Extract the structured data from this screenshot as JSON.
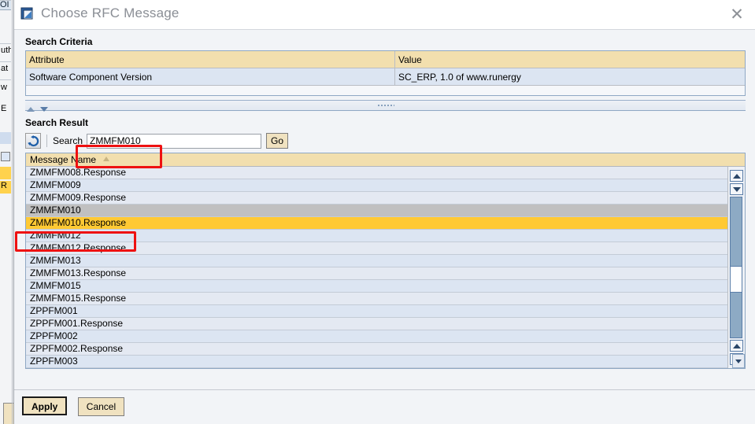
{
  "background": {
    "fragments": [
      "OI",
      "uth",
      "at",
      "w",
      "E",
      "R"
    ]
  },
  "dialog": {
    "title": "Choose RFC Message",
    "title_icon": "window-stack-icon",
    "close_icon": "close-icon"
  },
  "search_criteria": {
    "section_label": "Search Criteria",
    "columns": [
      "Attribute",
      "Value"
    ],
    "rows": [
      {
        "attribute": "Software Component Version",
        "value": "SC_ERP, 1.0 of www.runergy"
      }
    ]
  },
  "splitter": {
    "collapse_up_icon": "triangle-up-icon",
    "collapse_down_icon": "triangle-down-icon",
    "grip_icon": "grip-dots-icon"
  },
  "search_result": {
    "section_label": "Search Result",
    "refresh_icon": "refresh-icon",
    "search_label": "Search",
    "search_value": "ZMMFM010",
    "search_placeholder": "",
    "go_label": "Go",
    "column_header": "Message Name",
    "sort_icon": "sort-ascending-icon",
    "rows": [
      {
        "name": "ZMMFM008.Response",
        "state": "normal"
      },
      {
        "name": "ZMMFM009",
        "state": "normal"
      },
      {
        "name": "ZMMFM009.Response",
        "state": "normal"
      },
      {
        "name": "ZMMFM010",
        "state": "hover"
      },
      {
        "name": "ZMMFM010.Response",
        "state": "selected"
      },
      {
        "name": "ZMMFM012",
        "state": "normal"
      },
      {
        "name": "ZMMFM012.Response",
        "state": "normal"
      },
      {
        "name": "ZMMFM013",
        "state": "normal"
      },
      {
        "name": "ZMMFM013.Response",
        "state": "normal"
      },
      {
        "name": "ZMMFM015",
        "state": "normal"
      },
      {
        "name": "ZMMFM015.Response",
        "state": "normal"
      },
      {
        "name": "ZPPFM001",
        "state": "normal"
      },
      {
        "name": "ZPPFM001.Response",
        "state": "normal"
      },
      {
        "name": "ZPPFM002",
        "state": "normal"
      },
      {
        "name": "ZPPFM002.Response",
        "state": "normal"
      },
      {
        "name": "ZPPFM003",
        "state": "normal"
      }
    ],
    "scrollbar": {
      "up_icon": "scroll-up-icon",
      "down_icon": "scroll-down-icon",
      "thumb": "scroll-thumb"
    }
  },
  "footer": {
    "apply_label": "Apply",
    "cancel_label": "Cancel"
  },
  "colors": {
    "header_amber": "#f2dfae",
    "row_selected": "#ffc933",
    "row_hover": "#c0c0c0",
    "row_even": "#e4e9f2",
    "row_odd": "#dce5f2",
    "annotation_red": "#ee1111",
    "title_gray": "#8a8e95",
    "border_blue": "#8fa8c4"
  }
}
